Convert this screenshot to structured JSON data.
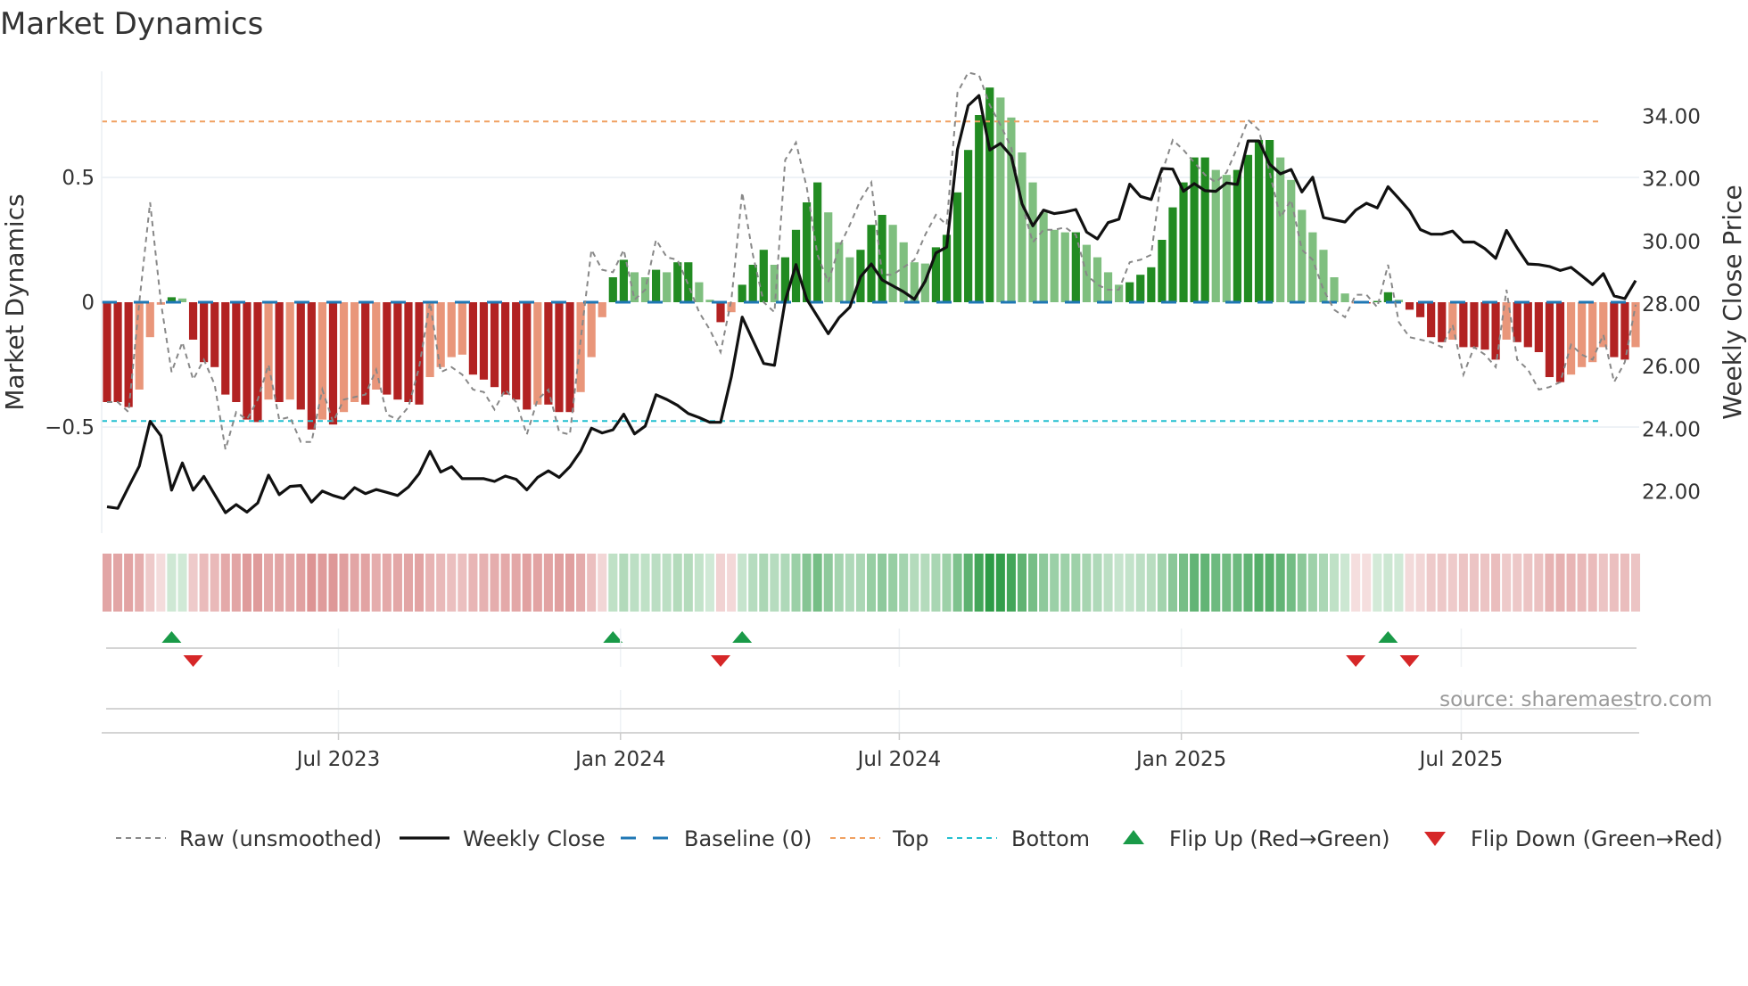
{
  "title": "Market Dynamics",
  "source": "source: sharemaestro.com",
  "chart_data": {
    "type": "bar",
    "title": "Market Dynamics",
    "ylabel": "Market Dynamics",
    "y2label": "Weekly Close Price",
    "ylim": [
      -0.84,
      0.97
    ],
    "y2lim": [
      20.8,
      36.1
    ],
    "yticks": [
      {
        "v": 0.5,
        "label": "0.5"
      },
      {
        "v": 0,
        "label": "0"
      },
      {
        "v": -0.5,
        "label": "−0.5"
      }
    ],
    "y2ticks": [
      {
        "v": 34,
        "label": "34.00"
      },
      {
        "v": 32,
        "label": "32.00"
      },
      {
        "v": 30,
        "label": "30.00"
      },
      {
        "v": 28,
        "label": "28.00"
      },
      {
        "v": 26,
        "label": "26.00"
      },
      {
        "v": 24,
        "label": "24.00"
      },
      {
        "v": 22,
        "label": "22.00"
      }
    ],
    "xticks": [
      {
        "index": 21.5,
        "label": "Jul 2023"
      },
      {
        "index": 47.7,
        "label": "Jan 2024"
      },
      {
        "index": 73.6,
        "label": "Jul 2024"
      },
      {
        "index": 99.8,
        "label": "Jan 2025"
      },
      {
        "index": 125.8,
        "label": "Jul 2025"
      }
    ],
    "top_level": 0.724,
    "bottom_level": -0.476,
    "baseline": 0,
    "smoothed": [
      -0.4,
      -0.4,
      -0.42,
      -0.35,
      -0.14,
      -0.01,
      0.02,
      0.015,
      -0.15,
      -0.24,
      -0.26,
      -0.37,
      -0.4,
      -0.47,
      -0.48,
      -0.39,
      -0.4,
      -0.39,
      -0.43,
      -0.51,
      -0.47,
      -0.49,
      -0.44,
      -0.4,
      -0.41,
      -0.35,
      -0.37,
      -0.39,
      -0.4,
      -0.41,
      -0.3,
      -0.26,
      -0.22,
      -0.21,
      -0.29,
      -0.31,
      -0.34,
      -0.37,
      -0.39,
      -0.43,
      -0.41,
      -0.41,
      -0.44,
      -0.44,
      -0.36,
      -0.22,
      -0.06,
      0.1,
      0.17,
      0.12,
      0.1,
      0.13,
      0.12,
      0.16,
      0.16,
      0.08,
      0.01,
      -0.08,
      -0.04,
      0.07,
      0.15,
      0.21,
      0.15,
      0.18,
      0.29,
      0.4,
      0.48,
      0.36,
      0.24,
      0.18,
      0.21,
      0.31,
      0.35,
      0.31,
      0.24,
      0.16,
      0.155,
      0.22,
      0.27,
      0.44,
      0.61,
      0.75,
      0.86,
      0.82,
      0.74,
      0.6,
      0.48,
      0.36,
      0.29,
      0.28,
      0.28,
      0.23,
      0.18,
      0.12,
      0.07,
      0.08,
      0.11,
      0.14,
      0.25,
      0.38,
      0.48,
      0.58,
      0.58,
      0.53,
      0.51,
      0.53,
      0.59,
      0.65,
      0.65,
      0.58,
      0.49,
      0.37,
      0.28,
      0.21,
      0.1,
      0.035,
      -0.005,
      -0.005,
      0.005,
      0.04,
      0.01,
      -0.03,
      -0.06,
      -0.14,
      -0.16,
      -0.15,
      -0.18,
      -0.18,
      -0.19,
      -0.23,
      -0.15,
      -0.16,
      -0.18,
      -0.2,
      -0.3,
      -0.32,
      -0.29,
      -0.26,
      -0.24,
      -0.18,
      -0.22,
      -0.23,
      -0.18
    ],
    "raw": [
      -0.4,
      -0.4,
      -0.44,
      0,
      0.4,
      0,
      -0.28,
      -0.16,
      -0.31,
      -0.23,
      -0.33,
      -0.59,
      -0.44,
      -0.47,
      -0.39,
      -0.25,
      -0.47,
      -0.46,
      -0.56,
      -0.56,
      -0.35,
      -0.48,
      -0.39,
      -0.38,
      -0.37,
      -0.27,
      -0.45,
      -0.47,
      -0.42,
      -0.26,
      0,
      -0.28,
      -0.26,
      -0.29,
      -0.35,
      -0.36,
      -0.43,
      -0.35,
      -0.4,
      -0.53,
      -0.39,
      -0.35,
      -0.52,
      -0.53,
      -0.15,
      0.21,
      0.13,
      0.12,
      0.21,
      0.01,
      0.05,
      0.25,
      0.18,
      0.17,
      0.07,
      -0.04,
      -0.11,
      -0.2,
      0.01,
      0.44,
      0.19,
      0,
      -0.04,
      0.57,
      0.64,
      0.46,
      0.19,
      0.08,
      0.22,
      0.31,
      0.41,
      0.48,
      0.11,
      0.11,
      0.14,
      0.17,
      0.27,
      0.35,
      0.31,
      0.84,
      0.92,
      0.91,
      0.79,
      0.71,
      0.62,
      0.39,
      0.24,
      0.29,
      0.29,
      0.3,
      0.27,
      0.11,
      0.07,
      0.05,
      0.05,
      0.16,
      0.17,
      0.19,
      0.52,
      0.65,
      0.61,
      0.56,
      0.51,
      0.48,
      0.52,
      0.62,
      0.73,
      0.69,
      0.52,
      0.34,
      0.41,
      0.21,
      0.17,
      0.05,
      -0.03,
      -0.06,
      0.03,
      0.03,
      -0.02,
      0.15,
      -0.08,
      -0.14,
      -0.15,
      -0.16,
      -0.18,
      -0.09,
      -0.29,
      -0.18,
      -0.21,
      -0.26,
      0.05,
      -0.23,
      -0.27,
      -0.35,
      -0.34,
      -0.32,
      -0.17,
      -0.21,
      -0.23,
      -0.13,
      -0.32,
      -0.24,
      -0.01
    ],
    "close": [
      21.52,
      21.47,
      22.15,
      22.82,
      24.25,
      23.79,
      22.05,
      22.92,
      22.05,
      22.49,
      21.91,
      21.33,
      21.59,
      21.35,
      21.64,
      22.53,
      21.91,
      22.17,
      22.2,
      21.67,
      22.02,
      21.88,
      21.78,
      22.13,
      21.94,
      22.07,
      21.98,
      21.88,
      22.15,
      22.58,
      23.29,
      22.63,
      22.8,
      22.42,
      22.42,
      22.42,
      22.33,
      22.5,
      22.4,
      22.06,
      22.46,
      22.67,
      22.46,
      22.8,
      23.3,
      24.03,
      23.88,
      23.98,
      24.48,
      23.85,
      24.1,
      25.1,
      24.95,
      24.76,
      24.5,
      24.37,
      24.22,
      24.22,
      25.68,
      27.58,
      26.84,
      26.1,
      26.04,
      28.1,
      29.26,
      28.15,
      27.6,
      27.05,
      27.56,
      27.9,
      28.87,
      29.28,
      28.77,
      28.58,
      28.39,
      28.15,
      28.73,
      29.63,
      29.82,
      32.94,
      34.34,
      34.66,
      32.92,
      33.13,
      32.73,
      31.2,
      30.5,
      31.0,
      30.89,
      30.94,
      31.02,
      30.3,
      30.08,
      30.6,
      30.71,
      31.83,
      31.44,
      31.34,
      32.33,
      32.31,
      31.6,
      31.85,
      31.62,
      31.6,
      31.87,
      31.82,
      33.21,
      33.21,
      32.47,
      32.16,
      32.3,
      31.58,
      32.05,
      30.76,
      30.69,
      30.62,
      31.0,
      31.22,
      31.07,
      31.75,
      31.37,
      30.98,
      30.38,
      30.23,
      30.23,
      30.33,
      29.98,
      29.98,
      29.77,
      29.46,
      30.35,
      29.79,
      29.28,
      29.26,
      29.2,
      29.07,
      29.17,
      28.9,
      28.62,
      28.97,
      28.26,
      28.17,
      28.75
    ],
    "flip_up": [
      6,
      47,
      59,
      119
    ],
    "flip_down": [
      8,
      57,
      116,
      121
    ],
    "colors": {
      "red_strong": "#b22222",
      "red_weak": "#e9967a",
      "green_strong": "#228b22",
      "green_weak": "#7fbf7f",
      "raw": "#888888",
      "close": "#111111",
      "baseline": "#1f77b4",
      "top": "#f0a060",
      "bottom": "#22bfd0",
      "flip_up": "#1a9a48",
      "flip_down": "#d62728"
    },
    "legend": {
      "position": "bottom",
      "items": [
        {
          "key": "raw",
          "label": "Raw (unsmoothed)"
        },
        {
          "key": "close",
          "label": "Weekly Close"
        },
        {
          "key": "baseline",
          "label": "Baseline (0)"
        },
        {
          "key": "top",
          "label": "Top"
        },
        {
          "key": "bottom",
          "label": "Bottom"
        },
        {
          "key": "flip_up",
          "label": "Flip Up (Red→Green)"
        },
        {
          "key": "flip_down",
          "label": "Flip Down (Green→Red)"
        }
      ]
    }
  }
}
